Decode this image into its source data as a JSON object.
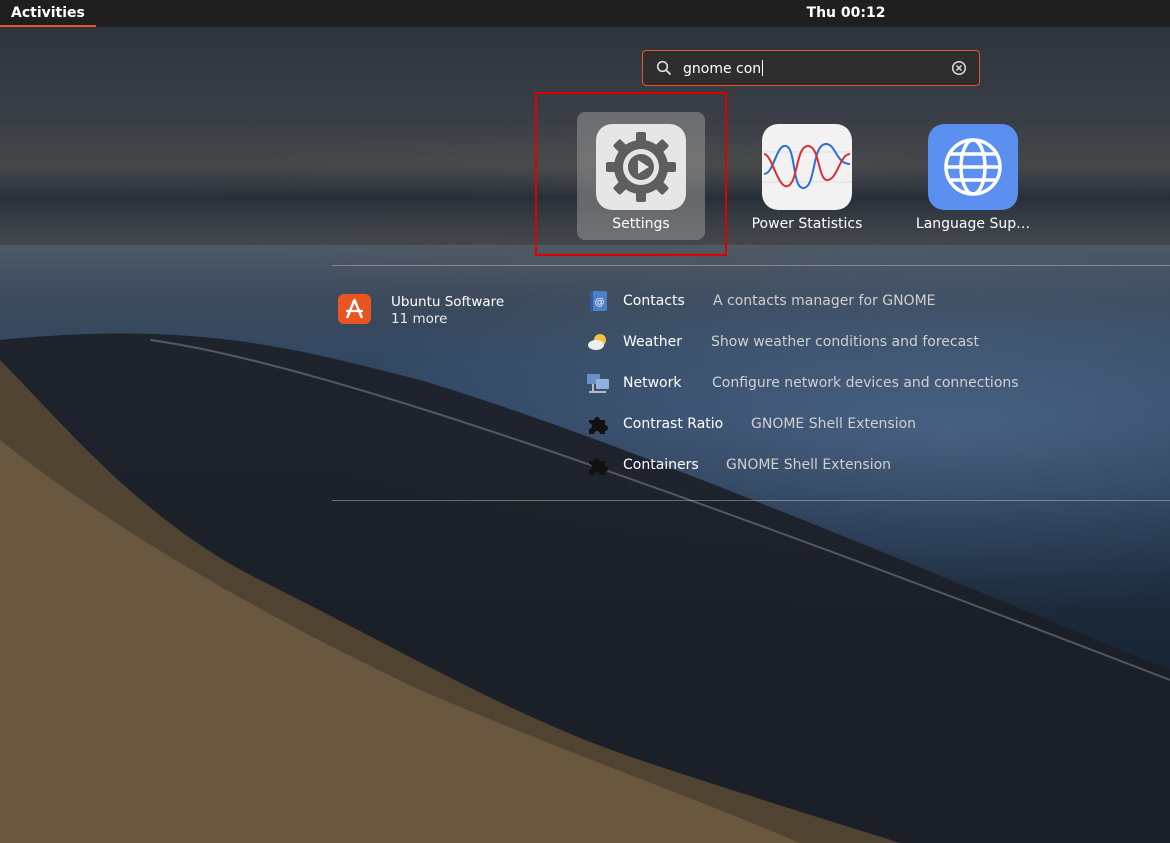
{
  "topbar": {
    "activities_label": "Activities",
    "clock": "Thu 00:12"
  },
  "search": {
    "query": "gnome con",
    "search_icon": "search-icon",
    "clear_icon": "clear-icon"
  },
  "apps": [
    {
      "label": "Settings",
      "icon": "settings-gear-icon",
      "selected": true
    },
    {
      "label": "Power Statistics",
      "icon": "power-statistics-icon",
      "selected": false
    },
    {
      "label": "Language Sup…",
      "icon": "language-globe-icon",
      "selected": false
    }
  ],
  "provider": {
    "name": "Ubuntu Software",
    "more": "11 more",
    "icon": "ubuntu-software-icon"
  },
  "results": [
    {
      "name": "Contacts",
      "desc": "A contacts manager for GNOME",
      "icon": "contacts-icon"
    },
    {
      "name": "Weather",
      "desc": "Show weather conditions and forecast",
      "icon": "weather-icon"
    },
    {
      "name": "Network",
      "desc": "Configure network devices and connections",
      "icon": "network-icon"
    },
    {
      "name": "Contrast Ratio",
      "desc": "GNOME Shell Extension",
      "icon": "puzzle-extension-icon"
    },
    {
      "name": "Containers",
      "desc": "GNOME Shell Extension",
      "icon": "puzzle-extension-icon"
    }
  ],
  "colors": {
    "accent": "#e95420",
    "highlight_box": "#e00000",
    "topbar": "#1f1f1f"
  }
}
